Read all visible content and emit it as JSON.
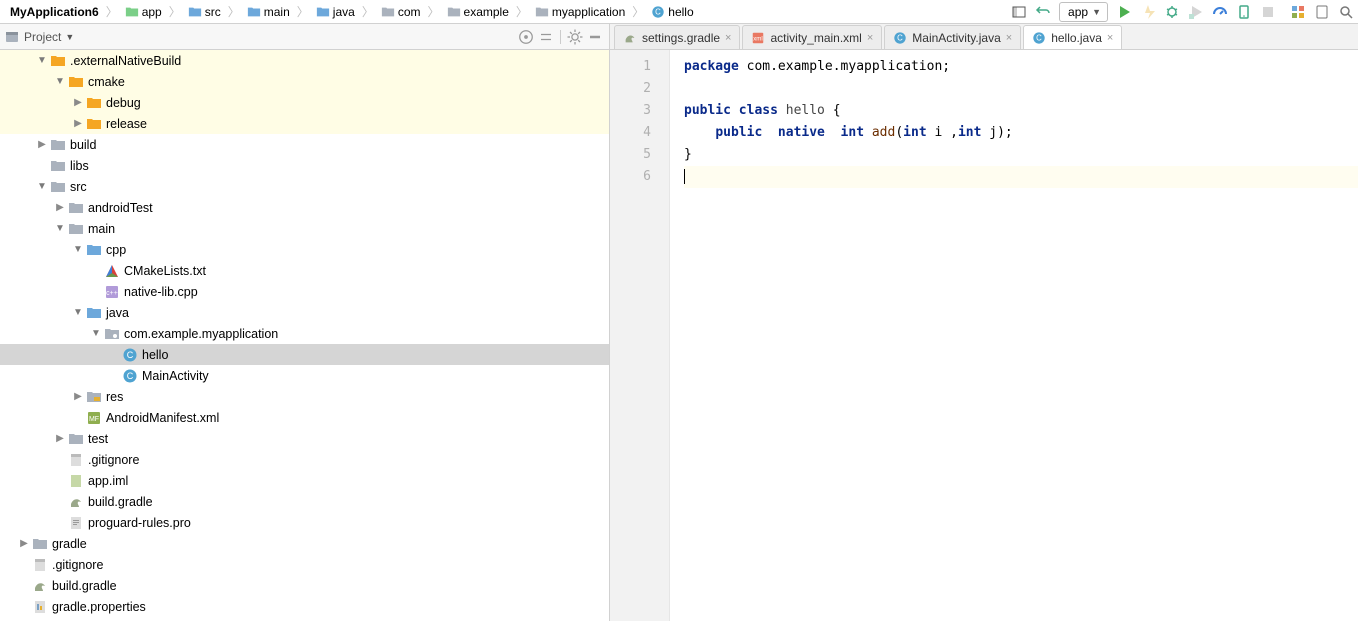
{
  "breadcrumb": {
    "items": [
      {
        "label": "MyApplication6",
        "bold": true,
        "icon": "project"
      },
      {
        "label": "app",
        "icon": "module"
      },
      {
        "label": "src",
        "icon": "folder-blue"
      },
      {
        "label": "main",
        "icon": "folder-blue"
      },
      {
        "label": "java",
        "icon": "folder-blue"
      },
      {
        "label": "com",
        "icon": "folder-gray"
      },
      {
        "label": "example",
        "icon": "folder-gray"
      },
      {
        "label": "myapplication",
        "icon": "folder-gray"
      },
      {
        "label": "hello",
        "icon": "class"
      }
    ]
  },
  "run_target": "app",
  "project_header": {
    "title": "Project"
  },
  "tabs": [
    {
      "label": "settings.gradle",
      "icon": "gradle",
      "active": false
    },
    {
      "label": "activity_main.xml",
      "icon": "xml",
      "active": false
    },
    {
      "label": "MainActivity.java",
      "icon": "class",
      "active": false
    },
    {
      "label": "hello.java",
      "icon": "class",
      "active": true
    }
  ],
  "tree": [
    {
      "depth": 1,
      "arrow": "open",
      "label": ".externalNativeBuild",
      "icon": "folder-org",
      "hi": true
    },
    {
      "depth": 2,
      "arrow": "open",
      "label": "cmake",
      "icon": "folder-org",
      "hi": true
    },
    {
      "depth": 3,
      "arrow": "right",
      "label": "debug",
      "icon": "folder-org",
      "hi": true
    },
    {
      "depth": 3,
      "arrow": "right",
      "label": "release",
      "icon": "folder-org",
      "hi": true
    },
    {
      "depth": 1,
      "arrow": "right",
      "label": "build",
      "icon": "folder-gray"
    },
    {
      "depth": 1,
      "arrow": "none",
      "label": "libs",
      "icon": "folder-gray"
    },
    {
      "depth": 1,
      "arrow": "open",
      "label": "src",
      "icon": "folder-gray"
    },
    {
      "depth": 2,
      "arrow": "right",
      "label": "androidTest",
      "icon": "folder-gray"
    },
    {
      "depth": 2,
      "arrow": "open",
      "label": "main",
      "icon": "folder-gray"
    },
    {
      "depth": 3,
      "arrow": "open",
      "label": "cpp",
      "icon": "folder-blue"
    },
    {
      "depth": 4,
      "arrow": "none",
      "label": "CMakeLists.txt",
      "icon": "cmake"
    },
    {
      "depth": 4,
      "arrow": "none",
      "label": "native-lib.cpp",
      "icon": "cpp"
    },
    {
      "depth": 3,
      "arrow": "open",
      "label": "java",
      "icon": "folder-blue"
    },
    {
      "depth": 4,
      "arrow": "open",
      "label": "com.example.myapplication",
      "icon": "package"
    },
    {
      "depth": 5,
      "arrow": "none",
      "label": "hello",
      "icon": "class",
      "sel": true
    },
    {
      "depth": 5,
      "arrow": "none",
      "label": "MainActivity",
      "icon": "class"
    },
    {
      "depth": 3,
      "arrow": "right",
      "label": "res",
      "icon": "folder-res"
    },
    {
      "depth": 3,
      "arrow": "none",
      "label": "AndroidManifest.xml",
      "icon": "manifest"
    },
    {
      "depth": 2,
      "arrow": "right",
      "label": "test",
      "icon": "folder-gray"
    },
    {
      "depth": 2,
      "arrow": "none",
      "label": ".gitignore",
      "icon": "git"
    },
    {
      "depth": 2,
      "arrow": "none",
      "label": "app.iml",
      "icon": "iml"
    },
    {
      "depth": 2,
      "arrow": "none",
      "label": "build.gradle",
      "icon": "gradle"
    },
    {
      "depth": 2,
      "arrow": "none",
      "label": "proguard-rules.pro",
      "icon": "text"
    },
    {
      "depth": 0,
      "arrow": "right",
      "label": "gradle",
      "icon": "folder-gray"
    },
    {
      "depth": 0,
      "arrow": "none",
      "label": ".gitignore",
      "icon": "git"
    },
    {
      "depth": 0,
      "arrow": "none",
      "label": "build.gradle",
      "icon": "gradle"
    },
    {
      "depth": 0,
      "arrow": "none",
      "label": "gradle.properties",
      "icon": "props"
    }
  ],
  "code": {
    "lines": [
      {
        "n": "1",
        "html": "<span class='kw'>package</span> com.example.myapplication;"
      },
      {
        "n": "2",
        "html": ""
      },
      {
        "n": "3",
        "html": "<span class='kw'>public class</span> <span class='cls'>hello</span> {"
      },
      {
        "n": "4",
        "html": "    <span class='kw'>public  native  int</span> <span class='fn'>add</span>(<span class='kw'>int</span> i ,<span class='kw'>int</span> j);"
      },
      {
        "n": "5",
        "html": "}"
      },
      {
        "n": "6",
        "html": "",
        "hl": true,
        "caret": true
      }
    ]
  },
  "icons": {
    "folder": "<svg viewBox='0 0 16 16'><path class='i-folder' d='M1 3h5l1 1h8v9H1z'/></svg>",
    "folder-gray": "<svg viewBox='0 0 16 16'><path fill='#aab2bd' d='M1 3h5l1 1h8v9H1z'/></svg>",
    "folder-blue": "<svg viewBox='0 0 16 16'><path fill='#6da8db' d='M1 3h5l1 1h8v9H1z'/></svg>",
    "folder-org": "<svg viewBox='0 0 16 16'><path fill='#f5a623' d='M1 3h5l1 1h8v9H1z'/></svg>",
    "folder-res": "<svg viewBox='0 0 16 16'><path fill='#aab2bd' d='M1 3h5l1 1h8v9H1z'/><rect x='8' y='8' width='6' height='4' fill='#e6b030'/></svg>",
    "module": "<svg viewBox='0 0 16 16'><path fill='#7bcf88' d='M1 3h5l1 1h8v9H1z'/></svg>",
    "project": "<svg viewBox='0 0 16 16'><rect x='2' y='3' width='12' height='10' rx='1' fill='#aab2bd'/><rect x='2' y='3' width='12' height='3' fill='#8a929c'/></svg>",
    "package": "<svg viewBox='0 0 16 16'><path fill='#aab2bd' d='M1 3h5l1 1h8v9H1z'/><circle cx='11' cy='10' r='2' fill='#fff'/></svg>",
    "class": "<svg viewBox='0 0 16 16'><circle cx='8' cy='8' r='6.5' fill='#4fa3d1'/><text x='8' y='11' text-anchor='middle' font-size='9' fill='#fff' font-family='Arial'>C</text></svg>",
    "gradle": "<svg viewBox='0 0 16 16'><path fill='#9aa88a' d='M3 10c2-6 8-6 10-2-1 0-2-1-3 0-1 2 1 3 1 5H3z'/></svg>",
    "xml": "<svg viewBox='0 0 16 16'><rect x='2' y='2' width='12' height='12' rx='1' fill='#e97862'/><text x='8' y='11' text-anchor='middle' font-size='7' fill='#fff'>xml</text></svg>",
    "manifest": "<svg viewBox='0 0 16 16'><rect x='2' y='2' width='12' height='12' rx='1' fill='#8fae4f'/><text x='8' y='11' text-anchor='middle' font-size='7' fill='#fff'>MF</text></svg>",
    "cmake": "<svg viewBox='0 0 16 16'><path fill='#d9413c' d='M8 2l6 12H2z'/><path fill='#3c7fd9' d='M8 2l-6 12 6-4z'/><path fill='#4caf50' d='M8 10l6 4H2z' opacity='.8'/></svg>",
    "cpp": "<svg viewBox='0 0 16 16'><rect x='2' y='2' width='12' height='12' rx='1' fill='#b19bd9'/><text x='8' y='11' text-anchor='middle' font-size='7' fill='#fff'>c++</text></svg>",
    "git": "<svg viewBox='0 0 16 16'><rect x='3' y='2' width='10' height='12' fill='#ddd'/><rect x='3' y='2' width='10' height='3' fill='#bbb'/></svg>",
    "iml": "<svg viewBox='0 0 16 16'><rect x='3' y='2' width='10' height='12' fill='#c6d8a7'/></svg>",
    "text": "<svg viewBox='0 0 16 16'><rect x='3' y='2' width='10' height='12' fill='#ddd'/><rect x='5' y='5' width='6' height='1' fill='#999'/><rect x='5' y='7' width='6' height='1' fill='#999'/><rect x='5' y='9' width='4' height='1' fill='#999'/></svg>",
    "props": "<svg viewBox='0 0 16 16'><rect x='3' y='2' width='10' height='12' fill='#ddd'/><rect x='5' y='5' width='2' height='6' fill='#7aa0c4'/><rect x='8' y='7' width='2' height='4' fill='#e6b030'/></svg>"
  }
}
